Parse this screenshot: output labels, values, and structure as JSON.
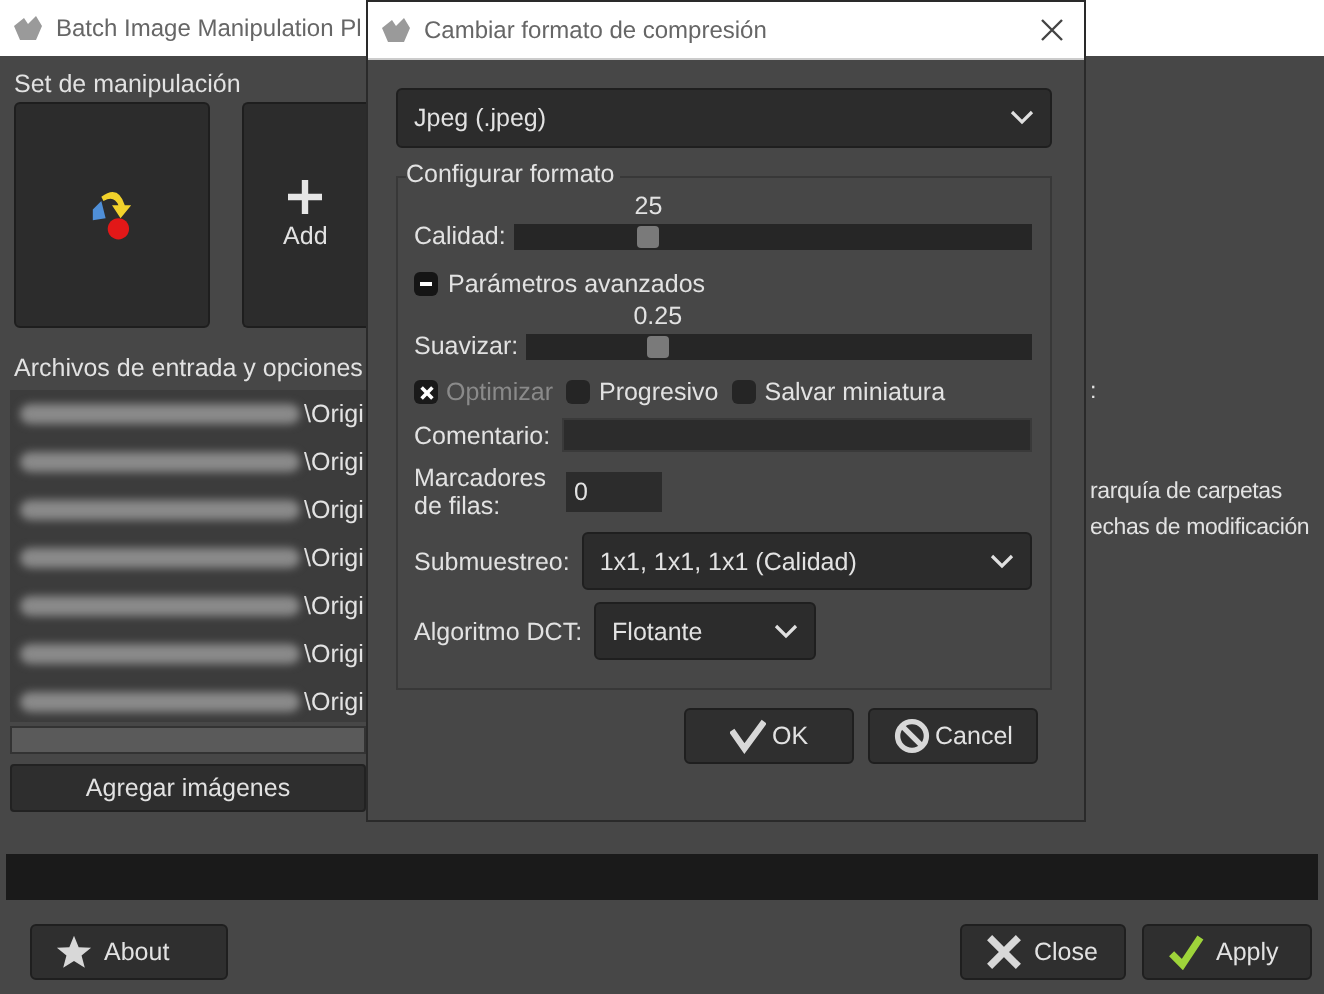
{
  "main_window": {
    "title": "Batch Image Manipulation Pl",
    "manipulation_set": {
      "label": "Set de manipulación",
      "add_label": "Add"
    },
    "input_files": {
      "label": "Archivos de entrada y opciones",
      "rows": [
        "\\Origi",
        "\\Origi",
        "\\Origi",
        "\\Origi",
        "\\Origi",
        "\\Origi",
        "\\Origi"
      ],
      "add_button": "Agregar imágenes"
    },
    "progress": {
      "level": 0
    },
    "right_texts": [
      ":",
      "rarquía de carpetas",
      "echas de modificación"
    ],
    "buttons": [
      {
        "label": "About",
        "kind": "about"
      },
      {
        "label": "Close",
        "kind": "close"
      },
      {
        "label": "Apply",
        "kind": "apply"
      }
    ]
  },
  "dialog": {
    "title": "Cambiar formato de compresión",
    "format": "Jpeg (.jpeg)",
    "group": "Configurar formato",
    "quality": {
      "label": "Calidad:",
      "reading": "25",
      "level": 0.26
    },
    "advanced": {
      "label": "Parámetros avanzados",
      "expanded": true
    },
    "smoothing": {
      "label": "Suavizar:",
      "reading": "0.25",
      "level": 0.26
    },
    "options": [
      {
        "label": "Optimizar",
        "checked": true,
        "disabled": true
      },
      {
        "label": "Progresivo",
        "checked": false,
        "disabled": false
      },
      {
        "label": "Salvar miniatura",
        "checked": false,
        "disabled": false
      }
    ],
    "comment": {
      "label": "Comentario:"
    },
    "row_markers": {
      "label": "Marcadores de filas:",
      "value": "0"
    },
    "subsampling": {
      "label": "Submuestreo:",
      "value": "1x1, 1x1, 1x1 (Calidad)"
    },
    "dct": {
      "label": "Algoritmo DCT:",
      "value": "Flotante"
    },
    "buttons": [
      {
        "label": "OK",
        "kind": "ok"
      },
      {
        "label": "Cancel",
        "kind": "cancel"
      }
    ]
  }
}
